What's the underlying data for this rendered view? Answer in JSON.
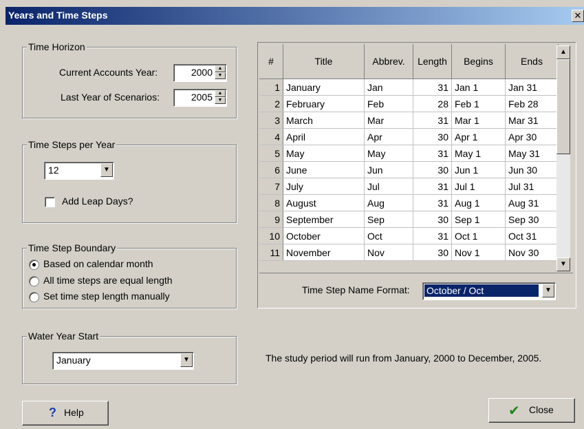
{
  "window": {
    "title": "Years and Time Steps",
    "close_glyph": "✕"
  },
  "time_horizon": {
    "legend": "Time Horizon",
    "current_accounts_year_label": "Current Accounts Year:",
    "current_accounts_year_value": "2000",
    "last_year_label": "Last Year of Scenarios:",
    "last_year_value": "2005"
  },
  "time_steps": {
    "legend": "Time Steps per Year",
    "value": "12",
    "add_leap_days_label": "Add Leap Days?"
  },
  "boundary": {
    "legend": "Time Step Boundary",
    "options": [
      {
        "label": "Based on calendar month",
        "selected": true
      },
      {
        "label": "All time steps are equal length",
        "selected": false
      },
      {
        "label": "Set time step length manually",
        "selected": false
      }
    ]
  },
  "water_year": {
    "legend": "Water Year Start",
    "value": "January"
  },
  "table": {
    "headers": [
      "#",
      "Title",
      "Abbrev.",
      "Length",
      "Begins",
      "Ends"
    ],
    "rows": [
      [
        "1",
        "January",
        "Jan",
        "31",
        "Jan 1",
        "Jan 31"
      ],
      [
        "2",
        "February",
        "Feb",
        "28",
        "Feb 1",
        "Feb 28"
      ],
      [
        "3",
        "March",
        "Mar",
        "31",
        "Mar 1",
        "Mar 31"
      ],
      [
        "4",
        "April",
        "Apr",
        "30",
        "Apr 1",
        "Apr 30"
      ],
      [
        "5",
        "May",
        "May",
        "31",
        "May 1",
        "May 31"
      ],
      [
        "6",
        "June",
        "Jun",
        "30",
        "Jun 1",
        "Jun 30"
      ],
      [
        "7",
        "July",
        "Jul",
        "31",
        "Jul 1",
        "Jul 31"
      ],
      [
        "8",
        "August",
        "Aug",
        "31",
        "Aug 1",
        "Aug 31"
      ],
      [
        "9",
        "September",
        "Sep",
        "30",
        "Sep 1",
        "Sep 30"
      ],
      [
        "10",
        "October",
        "Oct",
        "31",
        "Oct 1",
        "Oct 31"
      ],
      [
        "11",
        "November",
        "Nov",
        "30",
        "Nov 1",
        "Nov 30"
      ]
    ]
  },
  "name_format": {
    "label": "Time Step Name Format:",
    "value": "October / Oct"
  },
  "study_period_text": "The study period will run from January, 2000 to December, 2005.",
  "buttons": {
    "help": "Help",
    "close": "Close"
  }
}
